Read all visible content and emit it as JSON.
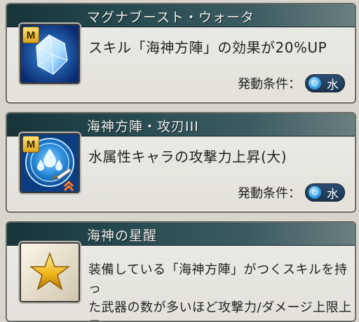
{
  "skills": [
    {
      "title": "マグナブースト・ウォータ",
      "badge": "M",
      "icon": "ice-crystal-icon",
      "description": "スキル「海神方陣」の効果が20%UP",
      "condition_label": "発動条件：",
      "element": "水"
    },
    {
      "title": "海神方陣・攻刃III",
      "badge": "M",
      "icon": "water-attack-up-icon",
      "description": "水属性キャラの攻撃力上昇(大)",
      "condition_label": "発動条件：",
      "element": "水"
    },
    {
      "title": "海神の星醒",
      "icon": "gold-star-icon",
      "description_line1": "装備している「海神方陣」がつくスキルを持っ",
      "description_line2": "た武器の数が多いほど攻撃力/ダメージ上限上昇"
    }
  ],
  "colors": {
    "header_dark": "#16343a",
    "element_pill": "#1b3350",
    "card_bg": "#ecebe6"
  }
}
